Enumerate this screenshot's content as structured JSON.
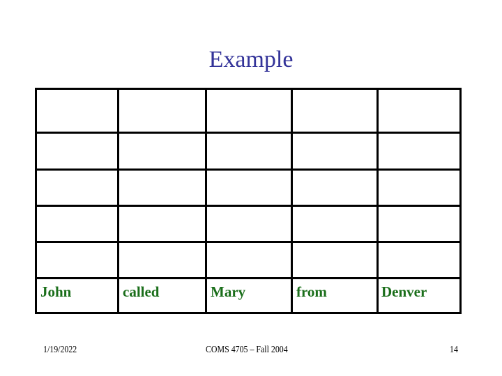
{
  "slide": {
    "title": "Example",
    "title_color": "#333399"
  },
  "table": {
    "rows": 6,
    "columns": 5,
    "cells": [
      [
        "",
        "",
        "",
        "",
        ""
      ],
      [
        "",
        "",
        "",
        "",
        ""
      ],
      [
        "",
        "",
        "",
        "",
        ""
      ],
      [
        "",
        "",
        "",
        "",
        ""
      ],
      [
        "",
        "",
        "",
        "",
        ""
      ],
      [
        "John",
        "called",
        "Mary",
        "from",
        "Denver"
      ]
    ],
    "text_color": "#1a6e1a"
  },
  "footer": {
    "date": "1/19/2022",
    "course": "COMS 4705 – Fall 2004",
    "page_number": "14"
  }
}
